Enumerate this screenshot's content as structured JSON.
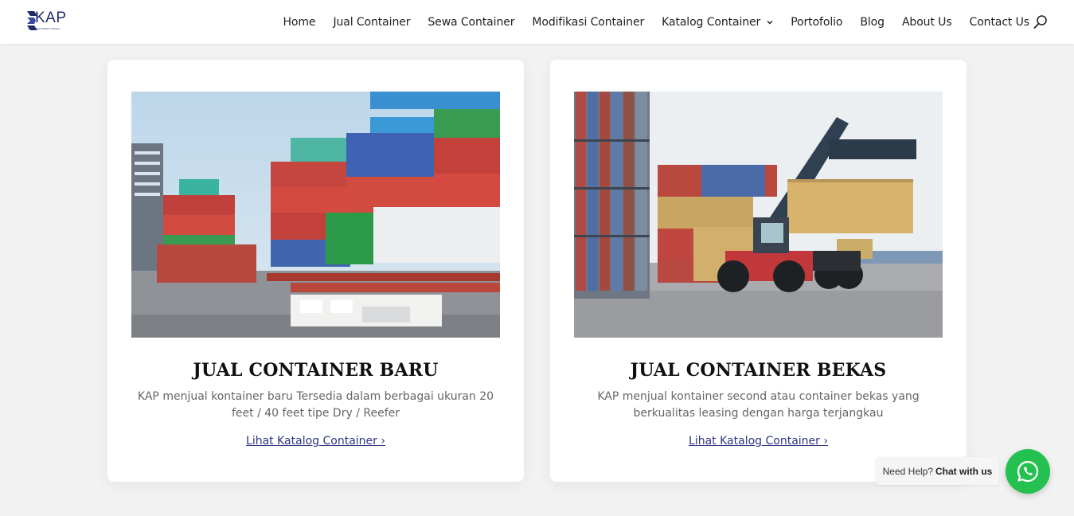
{
  "brand": {
    "name": "KAP",
    "tagline": "PT. Karunia Adhikara Perkasa",
    "color": "#1f2a6b"
  },
  "nav": {
    "items": [
      {
        "label": "Home"
      },
      {
        "label": "Jual Container"
      },
      {
        "label": "Sewa Container"
      },
      {
        "label": "Modifikasi Container"
      },
      {
        "label": "Katalog Container",
        "has_dropdown": true
      },
      {
        "label": "Portofolio"
      },
      {
        "label": "Blog"
      },
      {
        "label": "About Us"
      },
      {
        "label": "Contact Us"
      }
    ],
    "search_icon": "search-icon"
  },
  "cards": [
    {
      "title": "JUAL CONTAINER BARU",
      "description": "KAP menjual kontainer baru Tersedia dalam berbagai ukuran 20 feet / 40 feet tipe Dry / Reefer",
      "link": "Lihat Katalog Container ›",
      "image": "stacked-colorful-containers-photo"
    },
    {
      "title": "JUAL CONTAINER BEKAS",
      "description": "KAP menjual kontainer second atau container bekas yang berkualitas leasing dengan harga terjangkau",
      "link": "Lihat Katalog Container ›",
      "image": "reach-stacker-lifting-container-photo"
    }
  ],
  "whatsapp": {
    "prompt": "Need Help?",
    "action": "Chat with us",
    "icon": "whatsapp-icon",
    "color": "#25c150"
  },
  "colors": {
    "link": "#2d3480",
    "background": "#f2f2f2"
  }
}
